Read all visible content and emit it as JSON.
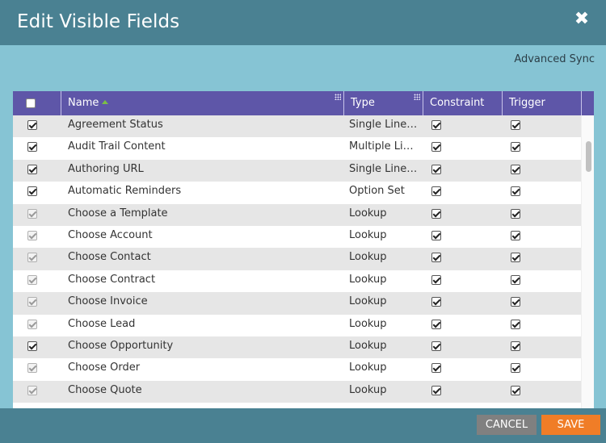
{
  "dialog": {
    "title": "Edit Visible Fields",
    "close_glyph": "✖"
  },
  "toolbar": {
    "advanced_sync": "Advanced Sync"
  },
  "grid": {
    "columns": [
      "Name",
      "Type",
      "Constraint",
      "Trigger"
    ],
    "rows": [
      {
        "name": "Agreement Status",
        "type": "Single Line ...",
        "selected": true,
        "dim": false,
        "constraint": true,
        "trigger": true
      },
      {
        "name": "Audit Trail Content",
        "type": "Multiple Lin...",
        "selected": true,
        "dim": false,
        "constraint": true,
        "trigger": true
      },
      {
        "name": "Authoring URL",
        "type": "Single Line ...",
        "selected": true,
        "dim": false,
        "constraint": true,
        "trigger": true
      },
      {
        "name": "Automatic Reminders",
        "type": "Option Set",
        "selected": true,
        "dim": false,
        "constraint": true,
        "trigger": true
      },
      {
        "name": "Choose a Template",
        "type": "Lookup",
        "selected": true,
        "dim": true,
        "constraint": true,
        "trigger": true
      },
      {
        "name": "Choose Account",
        "type": "Lookup",
        "selected": true,
        "dim": true,
        "constraint": true,
        "trigger": true
      },
      {
        "name": "Choose Contact",
        "type": "Lookup",
        "selected": true,
        "dim": true,
        "constraint": true,
        "trigger": true
      },
      {
        "name": "Choose Contract",
        "type": "Lookup",
        "selected": true,
        "dim": true,
        "constraint": true,
        "trigger": true
      },
      {
        "name": "Choose Invoice",
        "type": "Lookup",
        "selected": true,
        "dim": true,
        "constraint": true,
        "trigger": true
      },
      {
        "name": "Choose Lead",
        "type": "Lookup",
        "selected": true,
        "dim": true,
        "constraint": true,
        "trigger": true
      },
      {
        "name": "Choose Opportunity",
        "type": "Lookup",
        "selected": true,
        "dim": false,
        "constraint": true,
        "trigger": true
      },
      {
        "name": "Choose Order",
        "type": "Lookup",
        "selected": true,
        "dim": true,
        "constraint": true,
        "trigger": true
      },
      {
        "name": "Choose Quote",
        "type": "Lookup",
        "selected": true,
        "dim": true,
        "constraint": true,
        "trigger": true
      }
    ]
  },
  "footer": {
    "cancel_label": "CANCEL",
    "save_label": "SAVE"
  },
  "colors": {
    "header_bar": "#4a8192",
    "body": "#86c4d4",
    "grid_header": "#5e56a8",
    "save": "#f07d27",
    "cancel": "#808080"
  }
}
